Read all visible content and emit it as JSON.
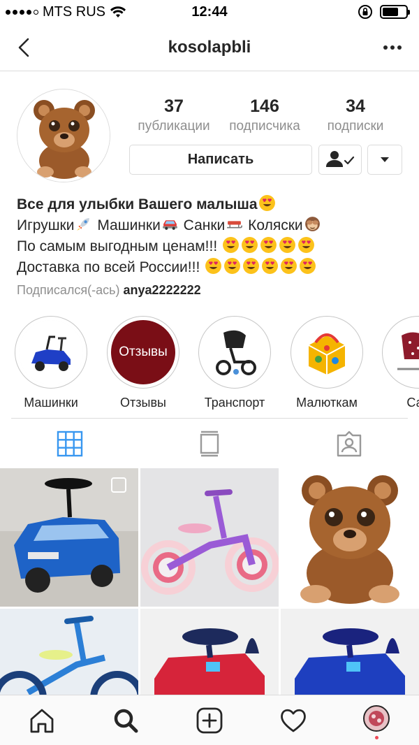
{
  "status_bar": {
    "carrier": "MTS RUS",
    "time": "12:44",
    "battery_level": 0.7
  },
  "nav": {
    "username": "kosolapbli",
    "back_icon": "chevron-left-icon",
    "more_icon": "more-horizontal-icon"
  },
  "profile": {
    "stats": [
      {
        "value": "37",
        "label": "публикации"
      },
      {
        "value": "146",
        "label": "подписчика"
      },
      {
        "value": "34",
        "label": "подписки"
      }
    ],
    "message_button": "Написать",
    "following_icon": "person-check-icon",
    "dropdown_icon": "caret-down-icon"
  },
  "bio": {
    "name": "Все для улыбки Вашего малыша",
    "line1": [
      "Игрушки",
      "Машинки",
      "Санки",
      "Коляски"
    ],
    "line2": "По самым выгодным ценам!!!",
    "line3": "Доставка по всей России!!!",
    "followed_prefix": "Подписался(-ась)",
    "followed_user": "anya2222222"
  },
  "highlights": [
    {
      "label": "Машинки"
    },
    {
      "label": "Отзывы",
      "cover_text": "Отзывы"
    },
    {
      "label": "Транспорт"
    },
    {
      "label": "Малюткам"
    },
    {
      "label": "Сан"
    }
  ],
  "tabs": [
    {
      "icon": "grid-icon",
      "active": true
    },
    {
      "icon": "feed-icon",
      "active": false
    },
    {
      "icon": "tagged-icon",
      "active": false
    }
  ],
  "bottom_nav": [
    {
      "icon": "home-icon"
    },
    {
      "icon": "search-icon"
    },
    {
      "icon": "add-post-icon"
    },
    {
      "icon": "heart-icon"
    },
    {
      "icon": "profile-avatar"
    }
  ],
  "colors": {
    "accent_blue": "#3897f0",
    "text": "#262626",
    "secondary_text": "#8e8e8e",
    "border": "#dbdbdb",
    "highlight_review_bg": "#7a0e16"
  }
}
